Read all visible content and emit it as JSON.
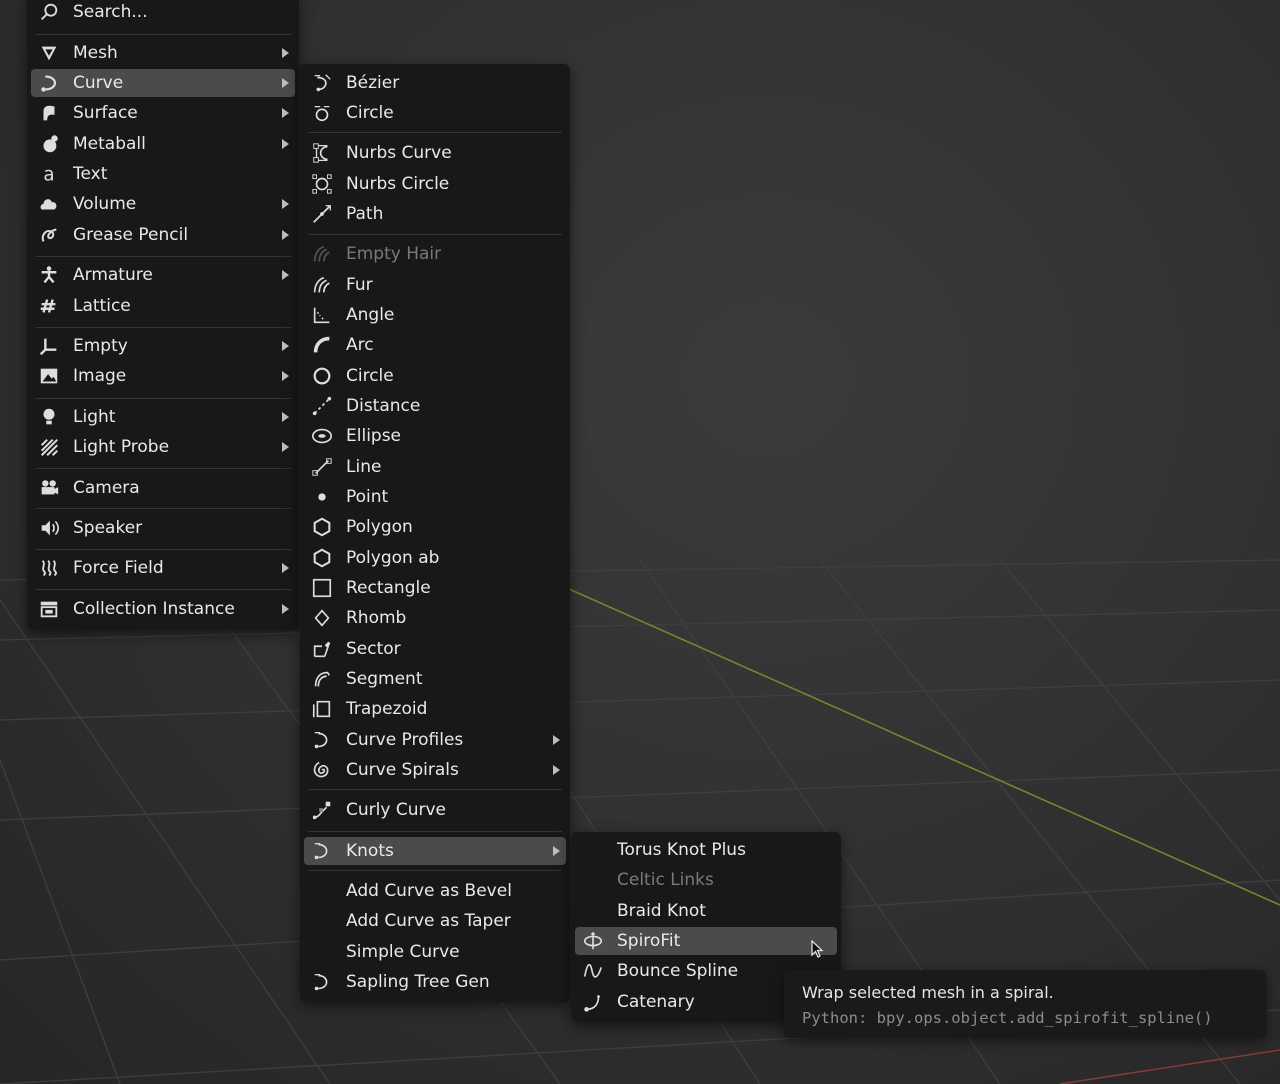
{
  "add_menu": {
    "search_placeholder": "Search...",
    "items": [
      {
        "label": "Mesh",
        "icon": "mesh-icon",
        "submenu": true
      },
      {
        "label": "Curve",
        "icon": "curve-icon",
        "submenu": true,
        "highlighted": true
      },
      {
        "label": "Surface",
        "icon": "surface-icon",
        "submenu": true
      },
      {
        "label": "Metaball",
        "icon": "metaball-icon",
        "submenu": true
      },
      {
        "label": "Text",
        "icon": "text-icon",
        "submenu": false
      },
      {
        "label": "Volume",
        "icon": "volume-icon",
        "submenu": true
      },
      {
        "label": "Grease Pencil",
        "icon": "grease-pencil-icon",
        "submenu": true
      },
      {
        "label": "Armature",
        "icon": "armature-icon",
        "submenu": true
      },
      {
        "label": "Lattice",
        "icon": "lattice-icon",
        "submenu": false
      },
      {
        "label": "Empty",
        "icon": "empty-icon",
        "submenu": true
      },
      {
        "label": "Image",
        "icon": "image-icon",
        "submenu": true
      },
      {
        "label": "Light",
        "icon": "light-icon",
        "submenu": true
      },
      {
        "label": "Light Probe",
        "icon": "light-probe-icon",
        "submenu": true
      },
      {
        "label": "Camera",
        "icon": "camera-icon",
        "submenu": false
      },
      {
        "label": "Speaker",
        "icon": "speaker-icon",
        "submenu": false
      },
      {
        "label": "Force Field",
        "icon": "force-field-icon",
        "submenu": true
      },
      {
        "label": "Collection Instance",
        "icon": "collection-instance-icon",
        "submenu": true
      }
    ]
  },
  "curve_menu": {
    "items": [
      {
        "label": "Bézier",
        "icon": "bezier-icon"
      },
      {
        "label": "Circle",
        "icon": "curve-circle-icon"
      },
      {
        "label": "Nurbs Curve",
        "icon": "nurbs-curve-icon"
      },
      {
        "label": "Nurbs Circle",
        "icon": "nurbs-circle-icon"
      },
      {
        "label": "Path",
        "icon": "path-icon"
      },
      {
        "label": "Empty Hair",
        "icon": "empty-hair-icon",
        "disabled": true
      },
      {
        "label": "Fur",
        "icon": "fur-icon"
      },
      {
        "label": "Angle",
        "icon": "angle-icon"
      },
      {
        "label": "Arc",
        "icon": "arc-icon"
      },
      {
        "label": "Circle",
        "icon": "circle-icon"
      },
      {
        "label": "Distance",
        "icon": "distance-icon"
      },
      {
        "label": "Ellipse",
        "icon": "ellipse-icon"
      },
      {
        "label": "Line",
        "icon": "line-icon"
      },
      {
        "label": "Point",
        "icon": "point-icon"
      },
      {
        "label": "Polygon",
        "icon": "polygon-icon"
      },
      {
        "label": "Polygon ab",
        "icon": "polygon-ab-icon"
      },
      {
        "label": "Rectangle",
        "icon": "rectangle-icon"
      },
      {
        "label": "Rhomb",
        "icon": "rhomb-icon"
      },
      {
        "label": "Sector",
        "icon": "sector-icon"
      },
      {
        "label": "Segment",
        "icon": "segment-icon"
      },
      {
        "label": "Trapezoid",
        "icon": "trapezoid-icon"
      },
      {
        "label": "Curve Profiles",
        "icon": "curve-profiles-icon",
        "submenu": true
      },
      {
        "label": "Curve Spirals",
        "icon": "curve-spirals-icon",
        "submenu": true
      },
      {
        "label": "Curly Curve",
        "icon": "curly-curve-icon"
      },
      {
        "label": "Knots",
        "icon": "knots-icon",
        "submenu": true,
        "highlighted": true
      },
      {
        "label": "Add Curve as Bevel",
        "icon": ""
      },
      {
        "label": "Add Curve as Taper",
        "icon": ""
      },
      {
        "label": "Simple Curve",
        "icon": ""
      },
      {
        "label": "Sapling Tree Gen",
        "icon": "sapling-icon"
      }
    ]
  },
  "knots_menu": {
    "items": [
      {
        "label": "Torus Knot Plus",
        "icon": ""
      },
      {
        "label": "Celtic Links",
        "icon": "",
        "disabled": true
      },
      {
        "label": "Braid Knot",
        "icon": ""
      },
      {
        "label": "SpiroFit",
        "icon": "spirofit-icon",
        "highlighted": true
      },
      {
        "label": "Bounce Spline",
        "icon": "bounce-spline-icon"
      },
      {
        "label": "Catenary",
        "icon": "catenary-icon"
      }
    ]
  },
  "tooltip": {
    "description": "Wrap selected mesh in a spiral.",
    "python": "Python: bpy.ops.object.add_spirofit_spline()"
  }
}
